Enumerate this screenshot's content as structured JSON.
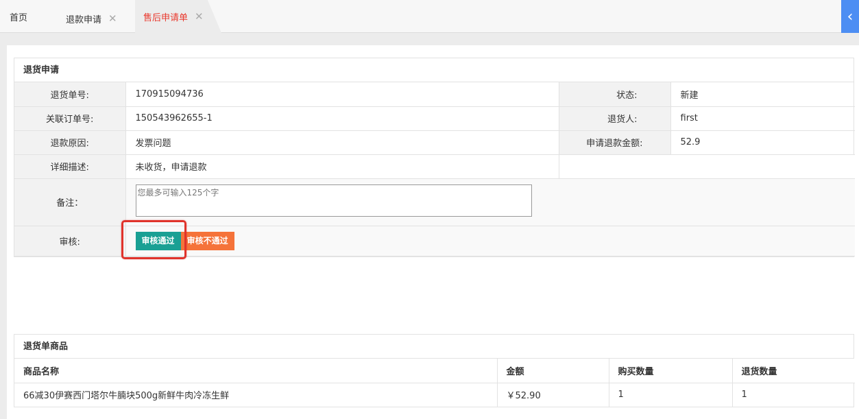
{
  "tabs": {
    "home": "首页",
    "refund": "退款申请",
    "active": "售后申请单",
    "close_glyph": "✕",
    "collapse_glyph": "‹"
  },
  "return_form": {
    "title": "退货申请",
    "rows": {
      "return_no_label": "退货单号:",
      "return_no": "170915094736",
      "status_label": "状态:",
      "status": "新建",
      "order_no_label": "关联订单号:",
      "order_no": "150543962655-1",
      "returner_label": "退货人:",
      "returner": "first",
      "reason_label": "退款原因:",
      "reason": "发票问题",
      "amount_label": "申请退款金额:",
      "amount": "52.9",
      "desc_label": "详细描述:",
      "desc": "未收货，申请退款",
      "remark_label": "备注：",
      "remark_placeholder": "您最多可输入125个字",
      "review_label": "审核:"
    },
    "buttons": {
      "approve": "审核通过",
      "reject": "审核不通过"
    }
  },
  "goods": {
    "title": "退货单商品",
    "columns": [
      "商品名称",
      "金额",
      "购买数量",
      "退货数量"
    ],
    "rows": [
      {
        "name": "66减30伊赛西门塔尔牛腩块500g新鲜牛肉冷冻生鲜",
        "amount": "￥52.90",
        "buy_qty": "1",
        "return_qty": "1"
      }
    ]
  },
  "colors": {
    "approve": "#1aa094",
    "reject": "#f5733a",
    "active_tab": "#e9392d",
    "highlight": "#e0332b"
  }
}
